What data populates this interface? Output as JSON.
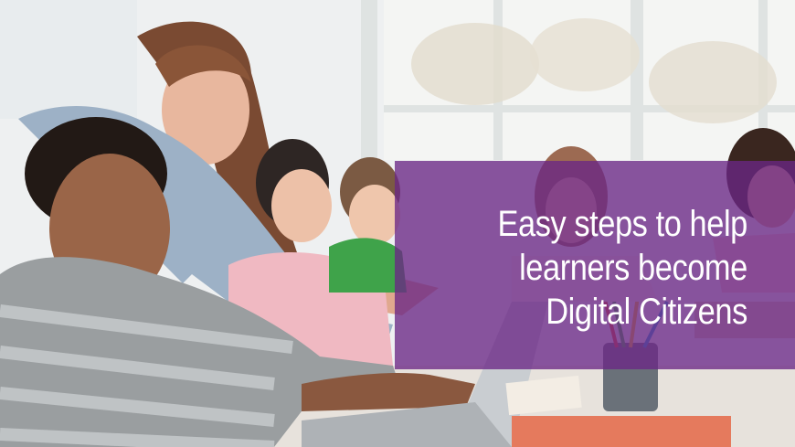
{
  "banner": {
    "headline_lines": [
      "Easy steps to help",
      "learners become",
      "Digital Citizens"
    ],
    "overlay_color": "#6a2685",
    "text_color": "#ffffff"
  },
  "photo": {
    "icon": "classroom-photo"
  }
}
